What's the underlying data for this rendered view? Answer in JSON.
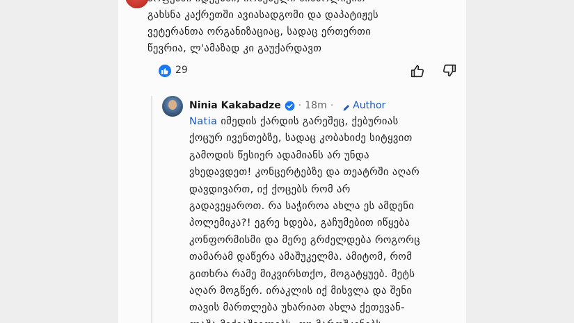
{
  "previous_comment": {
    "text_lines": [
      "სოფებში იდეებში, იოსებული სიმბოლიკით",
      "გახსნა კაქრეთში ავიასადგომი და დაპატიჟეს",
      "ვეტერანთა ორგანიზაციაც, სადაც ერთერთი",
      "წევრია, ლ'ამაზად კი გაუქარდავთ"
    ],
    "like_count": "29"
  },
  "reply": {
    "author_name": "Ninia Kakabadze",
    "time": "18m",
    "author_tag": "Author",
    "mention": "Natia",
    "first_line_rest": " იმედის ქარდის გარეშეც, ქებურიას",
    "lines": [
      "ქოცურ ივენთებზე, სადაც კობახიძე სიტყვით",
      "გამოდის წესიერ ადამიანს არ უნდა",
      "ვხედავდეთ! კონცერტებზე და თეატრში აღარ",
      "დავდივართ, იქ ქოცებს რომ არ",
      "გადავეყაროთ. რა საჭიროა ახლა ეს ამდენი",
      "პოლემიკა?! ეგრე ხდება, გაჩუმებით იწყება",
      "კონფორმისმი და მერე გრძელდება როგორც",
      "თამარამ დაწერა ამაშუკელმა. ამიტომ, რომ",
      "გითხრა რამე მიკვირსთქო, მოგატყუებ. მეტს",
      "აღარ მოგწერ. ირაკლის იქ მისვლა და შენი",
      "თავის მართლება უხარიათ ახლა ქეთევან-",
      "ლაშა მიქიაშვილებს, თუ მაროშკინებს."
    ]
  },
  "colors": {
    "mention_blue": "#1f56b8",
    "like_blue": "#1877f2",
    "verified_blue": "#1877f2"
  },
  "icons": {
    "like_badge": "thumbs-up-icon",
    "thumb_up": "thumbs-up-outline-icon",
    "thumb_down": "thumbs-down-outline-icon",
    "verified": "verified-badge-icon",
    "author_pen": "pencil-icon"
  }
}
